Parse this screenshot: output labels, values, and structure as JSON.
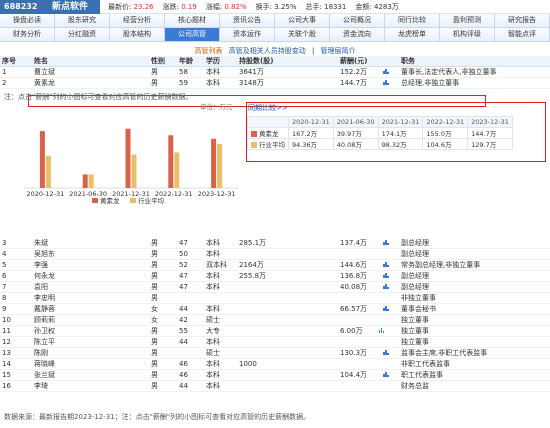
{
  "header": {
    "code": "688232",
    "name": "新点软件",
    "stats": [
      {
        "label": "最新价:",
        "value": "23.26",
        "red": true
      },
      {
        "label": "涨跌:",
        "value": "0.19",
        "red": true
      },
      {
        "label": "涨幅:",
        "value": "0.82%",
        "red": true
      },
      {
        "label": "换手:",
        "value": "3.25%",
        "red": false
      },
      {
        "label": "总手:",
        "value": "18331",
        "red": false
      },
      {
        "label": "金额:",
        "value": "4283万",
        "red": false
      }
    ]
  },
  "nav": {
    "row1": [
      "操盘必读",
      "股东研究",
      "经营分析",
      "核心题材",
      "资讯公告",
      "公司大事",
      "公司概况",
      "同行比较",
      "盈利预测",
      "研究报告"
    ],
    "row2": [
      "财务分析",
      "分红融资",
      "股本结构",
      "公司高管",
      "资本运作",
      "关联个股",
      "资金流向",
      "龙虎榜单",
      "机构评级",
      "智能点评"
    ],
    "active": "公司高管"
  },
  "subtabs": {
    "current": "高管列表",
    "links": [
      "高管及相关人员持股变动",
      "管理层简介"
    ],
    "sep": "|"
  },
  "table": {
    "headers": [
      "序号",
      "姓名",
      "性别",
      "年龄",
      "学历",
      "持股数(股)",
      "薪酬(元)",
      "职务"
    ],
    "top_rows": [
      [
        "1",
        "曹立斌",
        "男",
        "58",
        "本科",
        "3641万",
        "152.2万",
        "董事长,法定代表人,非独立董事"
      ],
      [
        "2",
        "黄素龙",
        "男",
        "59",
        "本科",
        "3148万",
        "144.7万",
        "总经理,非独立董事"
      ]
    ],
    "rows": [
      [
        "3",
        "朱斌",
        "男",
        "47",
        "本科",
        "285.1万",
        "137.4万",
        "副总经理"
      ],
      [
        "4",
        "吴旭东",
        "男",
        "50",
        "本科",
        "",
        "",
        "副总经理"
      ],
      [
        "5",
        "李强",
        "男",
        "52",
        "双本科",
        "2164万",
        "144.6万",
        "常务副总经理,非独立董事"
      ],
      [
        "6",
        "何永龙",
        "男",
        "47",
        "本科",
        "255.8万",
        "136.8万",
        "副总经理"
      ],
      [
        "7",
        "袁阳",
        "男",
        "47",
        "本科",
        "",
        "40.08万",
        "副总经理"
      ],
      [
        "8",
        "李忠明",
        "男",
        "",
        "",
        "",
        "",
        "非独立董事"
      ],
      [
        "9",
        "戴静蓉",
        "女",
        "44",
        "本科",
        "",
        "66.57万",
        "董事会秘书"
      ],
      [
        "10",
        "顾莉莉",
        "女",
        "42",
        "硕士",
        "",
        "",
        "独立董事"
      ],
      [
        "11",
        "孙卫权",
        "男",
        "55",
        "大专",
        "",
        "6.00万",
        "独立董事"
      ],
      [
        "12",
        "陈立平",
        "男",
        "44",
        "本科",
        "",
        "",
        "独立董事"
      ],
      [
        "13",
        "陈刚",
        "男",
        "",
        "硕士",
        "",
        "130.3万",
        "监事会主席,非职工代表监事"
      ],
      [
        "14",
        "蒋晓峰",
        "男",
        "46",
        "本科",
        "1000",
        "",
        "非职工代表监事"
      ],
      [
        "15",
        "张兰斌",
        "男",
        "46",
        "本科",
        "",
        "104.4万",
        "职工代表监事"
      ],
      [
        "16",
        "李琦",
        "男",
        "44",
        "本科",
        "",
        "",
        "财务总监"
      ]
    ],
    "salary_icon_rows": [
      1,
      2,
      3,
      5,
      6,
      7,
      9,
      11,
      13,
      15
    ]
  },
  "note1": "注：点击\"薪酬\"列的小图标可查看对应高管的历史薪酬数据。",
  "chart_data": {
    "type": "bar",
    "unit_label": "单位：万元",
    "categories": [
      "2020-12-31",
      "2021-06-30",
      "2021-12-31",
      "2022-12-31",
      "2023-12-31"
    ],
    "series": [
      {
        "name": "黄素龙",
        "values": [
          167.2,
          39.97,
          174.1,
          155.0,
          144.7
        ],
        "color": "#d9634a"
      },
      {
        "name": "行业平均",
        "values": [
          94.36,
          40.08,
          98.32,
          104.6,
          129.7
        ],
        "color": "#e8c06a"
      }
    ],
    "ylim": [
      0,
      200
    ],
    "legend": "bottom"
  },
  "compare": {
    "title": "同期比较>>",
    "headers": [
      "",
      "2020-12-31",
      "2021-06-30",
      "2021-12-31",
      "2022-12-31",
      "2023-12-31"
    ],
    "rows": [
      [
        "黄素龙",
        "167.2万",
        "39.97万",
        "174.1万",
        "155.0万",
        "144.7万"
      ],
      [
        "行业平均",
        "94.36万",
        "40.08万",
        "98.32万",
        "104.6万",
        "129.7万"
      ]
    ]
  },
  "footer": "数据来源：最新报告期2023-12-31；注：点击\"薪酬\"列的小图标可查看对应高管的历史薪酬数据。"
}
